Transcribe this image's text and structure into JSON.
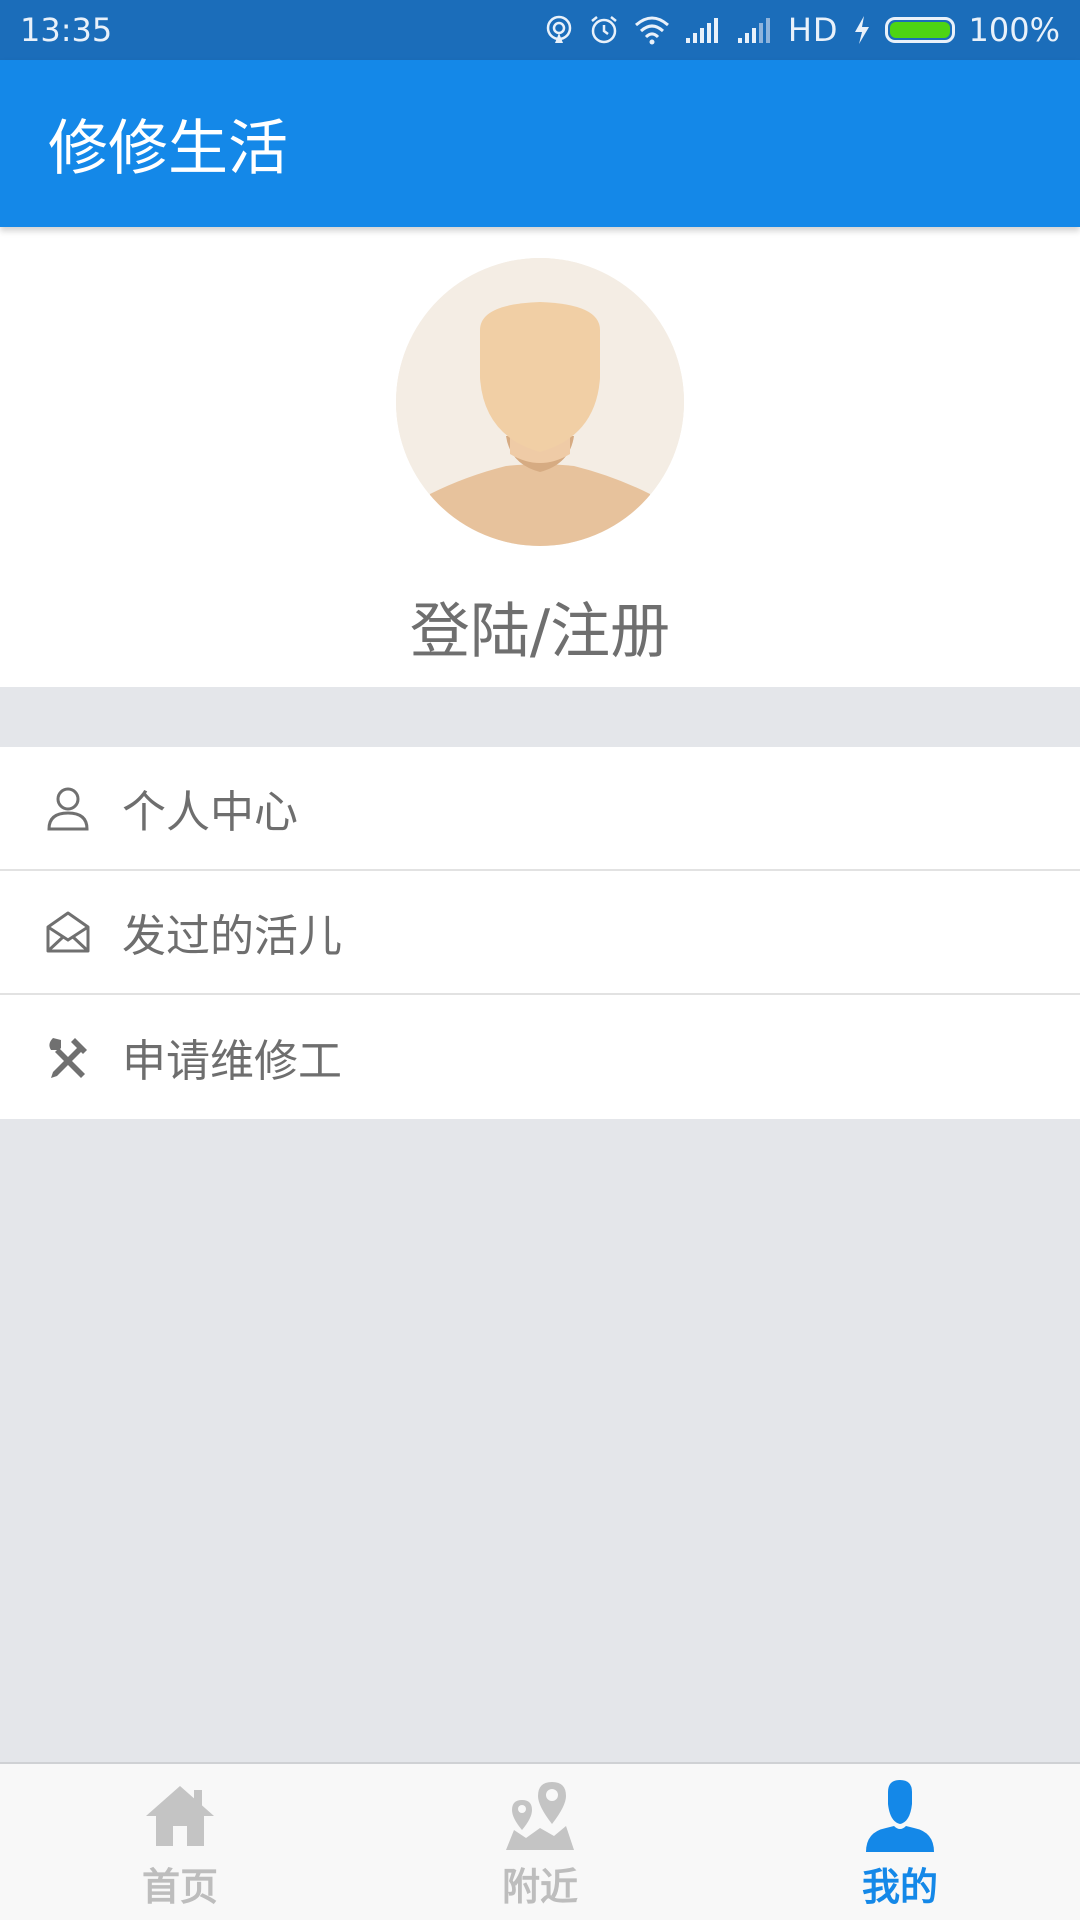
{
  "status_bar": {
    "time": "13:35",
    "network_label": "HD",
    "battery_percent": "100%",
    "battery_level": 1.0,
    "icons": [
      "hotspot-icon",
      "alarm-icon",
      "wifi-icon",
      "signal-icon",
      "signal-icon",
      "charging-icon",
      "battery-icon"
    ]
  },
  "app_bar": {
    "title": "修修生活"
  },
  "profile": {
    "login_label": "登陆/注册",
    "avatar_icon": "default-avatar"
  },
  "menu": {
    "items": [
      {
        "label": "个人中心",
        "icon": "person-icon"
      },
      {
        "label": "发过的活儿",
        "icon": "envelope-icon"
      },
      {
        "label": "申请维修工",
        "icon": "tools-icon"
      }
    ]
  },
  "bottom_nav": {
    "items": [
      {
        "label": "首页",
        "icon": "home-icon",
        "active": false
      },
      {
        "label": "附近",
        "icon": "map-pin-icon",
        "active": false
      },
      {
        "label": "我的",
        "icon": "user-icon",
        "active": true
      }
    ]
  },
  "colors": {
    "status_bar": "#1b6dba",
    "app_bar": "#1488e8",
    "background": "#e4e6ea",
    "active_tab": "#1488e8",
    "inactive_tab": "#bdbdbd",
    "text_gray": "#6e6e6e"
  }
}
